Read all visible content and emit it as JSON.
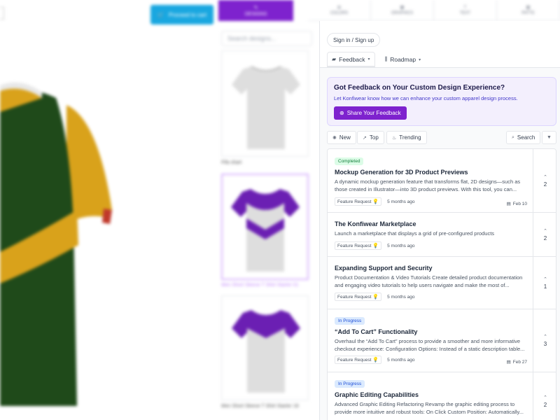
{
  "background": {
    "cart_button": "Proceed to cart",
    "designs_tab": "DESIGNS",
    "tabs": [
      "COLORS",
      "GRAPHICS",
      "TEXT",
      "PATTE"
    ],
    "search_placeholder": "Search designs...",
    "products": [
      {
        "label": "Fifa shart"
      },
      {
        "label": "Men Short Sleeve T Shirt Starter 01"
      },
      {
        "label": "Men Short Sleeve T Shirt Starter 18"
      }
    ],
    "colors": {
      "green": "#1f4a1a",
      "yellow": "#d9a21b",
      "red": "#c0392b",
      "purple": "#6b1fb3"
    }
  },
  "panel": {
    "signin": "Sign in / Sign up",
    "nav": [
      {
        "label": "Feedback",
        "icon": "feedback-icon"
      },
      {
        "label": "Roadmap",
        "icon": "roadmap-icon"
      }
    ],
    "banner": {
      "title": "Got Feedback on Your Custom Design Experience?",
      "subtitle": "Let Konfiwear know how we can enhance your custom apparel design process.",
      "button": "Share Your Feedback"
    },
    "filters": {
      "new": "New",
      "top": "Top",
      "trending": "Trending",
      "search": "Search"
    },
    "posts": [
      {
        "status": "Completed",
        "title": "Mockup Generation for 3D Product Previews",
        "desc": "A dynamic mockup generation feature that transforms flat, 2D designs—such as those created in Illustrator—into 3D product previews. With this tool, you can...",
        "tag": "Feature Request",
        "time": "5 months ago",
        "date": "Feb 10",
        "votes": "2"
      },
      {
        "status": "",
        "title": "The Konfiwear Marketplace",
        "desc": "Launch a marketplace that displays a grid of pre-configured products",
        "tag": "Feature Request",
        "time": "5 months ago",
        "date": "",
        "votes": "2"
      },
      {
        "status": "",
        "title": "Expanding Support and Security",
        "desc": "Product Documentation & Video Tutorials Create detailed product documentation and engaging video tutorials to help users navigate and make the most of...",
        "tag": "Feature Request",
        "time": "5 months ago",
        "date": "",
        "votes": "1"
      },
      {
        "status": "In Progress",
        "title": "“Add To Cart” Functionality",
        "desc": "Overhaul the “Add To Cart” process to provide a smoother and more informative checkout experience: Configuration Options: Instead of a static description table...",
        "tag": "Feature Request",
        "time": "5 months ago",
        "date": "Feb 27",
        "votes": "3"
      },
      {
        "status": "In Progress",
        "title": "Graphic Editing Capabilities",
        "desc": "Advanced Graphic Editing Refactoring Revamp the graphic editing process to provide more intuitive and robust tools: On Click Custom Position: Automatically...",
        "tag": "",
        "time": "",
        "date": "",
        "votes": "2"
      }
    ],
    "colors": {
      "accent": "#7e22ce",
      "completed": "#15803d",
      "in_progress": "#1d4ed8"
    }
  }
}
